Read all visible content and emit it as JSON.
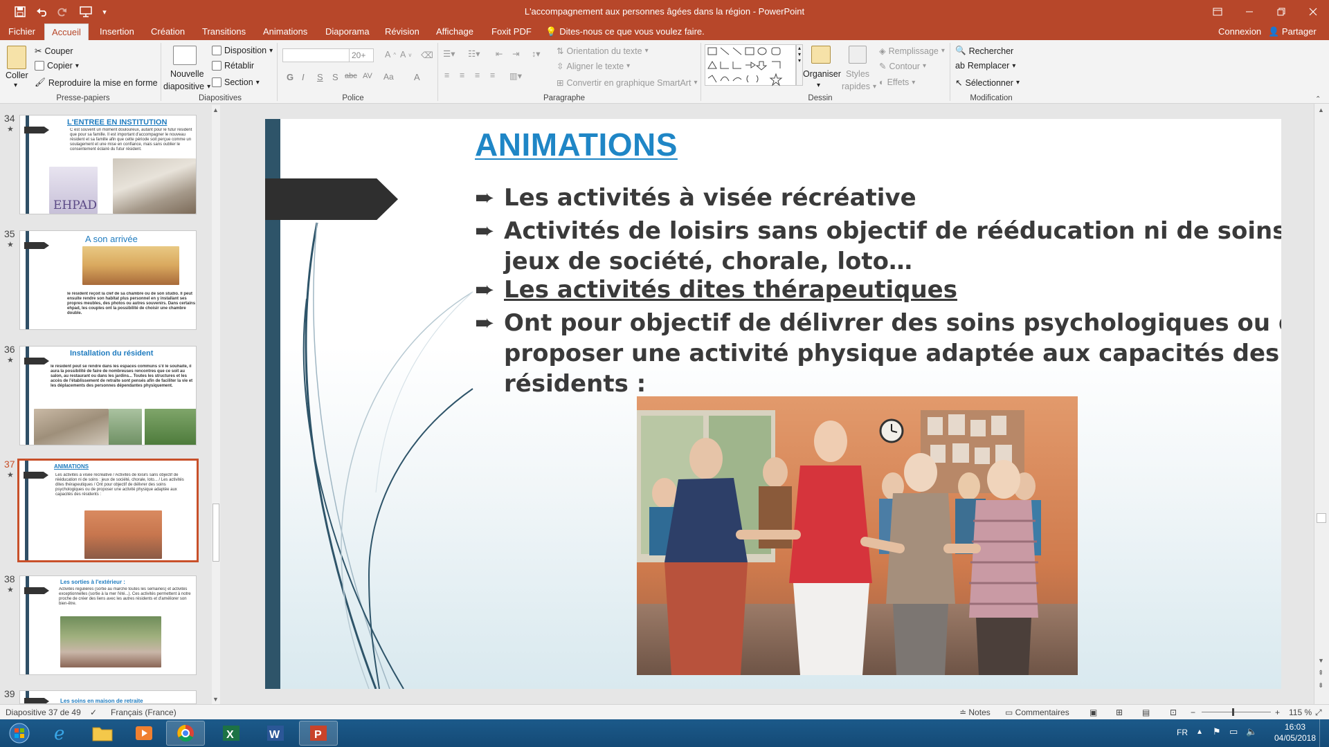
{
  "window": {
    "title": "L'accompagnement aux personnes âgées dans la région - PowerPoint"
  },
  "ribbon_tabs": [
    "Fichier",
    "Accueil",
    "Insertion",
    "Création",
    "Transitions",
    "Animations",
    "Diaporama",
    "Révision",
    "Affichage",
    "Foxit PDF"
  ],
  "tell_me": "Dites-nous ce que vous voulez faire.",
  "signin": "Connexion",
  "share": "Partager",
  "ribbon": {
    "clipboard": {
      "paste": "Coller",
      "cut": "Couper",
      "copy": "Copier",
      "format_painter": "Reproduire la mise en forme",
      "label": "Presse-papiers"
    },
    "slides": {
      "new_slide_1": "Nouvelle",
      "new_slide_2": "diapositive",
      "layout": "Disposition",
      "reset": "Rétablir",
      "section": "Section",
      "label": "Diapositives"
    },
    "font": {
      "size": "20+",
      "label": "Police"
    },
    "paragraph": {
      "text_direction": "Orientation du texte",
      "align_text": "Aligner le texte",
      "smartart": "Convertir en graphique SmartArt",
      "label": "Paragraphe"
    },
    "drawing": {
      "arrange": "Organiser",
      "styles_1": "Styles",
      "styles_2": "rapides",
      "fill": "Remplissage",
      "outline": "Contour",
      "effects": "Effets",
      "label": "Dessin"
    },
    "editing": {
      "find": "Rechercher",
      "replace": "Remplacer",
      "select": "Sélectionner",
      "label": "Modification"
    }
  },
  "thumbnails": [
    {
      "number": "34",
      "title": "L'ENTREE EN INSTITUTION",
      "text": "C est souvent un moment douloureux, autant pour le futur résident que pour sa famille. Il est important d'accompagner le nouveau résident et sa famille afin que cette période soit perçue comme un soulagement et une mise en confiance, mais sans oublier le consentement éclairé du futur résident.",
      "logo": "EHPAD"
    },
    {
      "number": "35",
      "title": "A son arrivée",
      "text": "le résident reçoit la clef de sa chambre ou de son studio. Il peut ensuite rendre son habitat plus personnel en y installant ses propres meubles, des photos ou autres souvenirs. Dans certains ehpad, les couples ont la possibilité de choisir une chambre double."
    },
    {
      "number": "36",
      "title": "Installation du résident",
      "text": "le résident peut se rendre dans les espaces communs s'il le souhaite, il aura la possibilité de faire de nombreuses rencontres que ce soit au salon, au restaurant ou dans les jardins... Toutes les structures et les accès de l'établissement de retraite sont pensés afin de faciliter la vie et les déplacements des personnes dépendantes physiquement."
    },
    {
      "number": "37",
      "title": "ANIMATIONS",
      "text": "Les activités à visée récréative / Activités de loisirs sans objectif de rééducation ni de soins : jeux de société, chorale, loto... / Les activités dites thérapeutiques / Ont pour objectif de délivrer des soins psychologiques ou de proposer une activité physique adaptée aux capacités des résidents :"
    },
    {
      "number": "38",
      "title": "Les sorties à l'extérieur :",
      "text": "Activités régulières (sortie au marché toutes les semaines) et activités exceptionnelles (sortie à la mer l'été...). Ces activités permettent à notre proche de créer des liens avec les autres résidents et d'améliorer son bien-être."
    },
    {
      "number": "39",
      "title": "Les soins en maison de retraite"
    }
  ],
  "slide": {
    "title": "ANIMATIONS",
    "bullets": [
      {
        "lines": [
          "Les activités à visée récréative"
        ],
        "underline": false
      },
      {
        "lines": [
          "Activités de loisirs sans objectif de rééducation ni de soins :",
          "jeux de société, chorale, loto…"
        ],
        "underline": false
      },
      {
        "lines": [
          "Les activités dites thérapeutiques"
        ],
        "underline": true
      },
      {
        "lines": [
          "Ont pour objectif de délivrer des soins psychologiques ou de",
          "proposer une activité physique adaptée aux capacités des",
          "résidents :"
        ],
        "underline": false
      }
    ]
  },
  "status": {
    "slide_counter": "Diapositive 37 de 49",
    "language": "Français (France)",
    "notes": "Notes",
    "comments": "Commentaires",
    "zoom": "115 %"
  },
  "taskbar": {
    "lang": "FR",
    "time": "16:03",
    "date": "04/05/2018"
  },
  "colors": {
    "accent": "#b7472a",
    "slide_title": "#1f86c6",
    "slide_bar": "#2e5469",
    "selected_thumb_border": "#c8502a"
  }
}
